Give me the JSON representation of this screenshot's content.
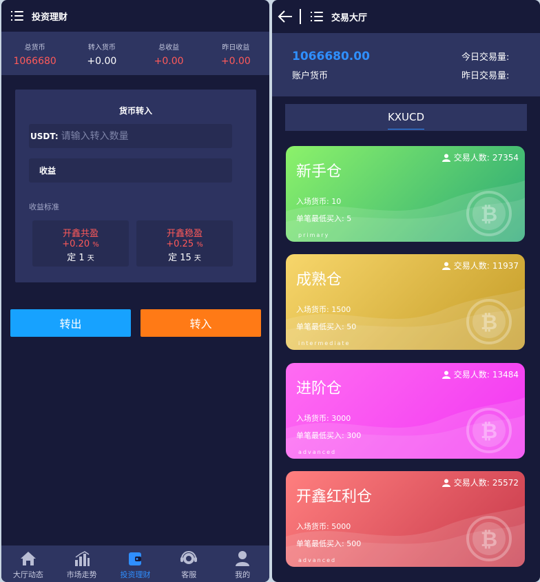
{
  "left": {
    "header_title": "投资理财",
    "stats": [
      {
        "label": "总货币",
        "value": "1066680",
        "color": "red"
      },
      {
        "label": "转入货币",
        "value": "+0.00",
        "color": "white"
      },
      {
        "label": "总收益",
        "value": "+0.00",
        "color": "red"
      },
      {
        "label": "昨日收益",
        "value": "+0.00",
        "color": "red"
      }
    ],
    "transfer": {
      "title": "货币转入",
      "usdt_label": "USDT:",
      "usdt_placeholder": "请输入转入数量",
      "usdt_value": "",
      "income_label": "收益",
      "standard_label": "收益标准",
      "plans": [
        {
          "name": "开鑫共盈",
          "rate": "+0.20",
          "rate_unit": "%",
          "term_prefix": "定",
          "term_value": "1",
          "term_unit": "天"
        },
        {
          "name": "开鑫稳盈",
          "rate": "+0.25",
          "rate_unit": "%",
          "term_prefix": "定",
          "term_value": "15",
          "term_unit": "天"
        }
      ]
    },
    "buttons": {
      "out_label": "转出",
      "in_label": "转入",
      "out_color": "#17a2ff",
      "in_color": "#ff7a16"
    },
    "tabs": [
      {
        "label": "大厅动态",
        "icon": "home-icon",
        "active": false
      },
      {
        "label": "市场走势",
        "icon": "chart-icon",
        "active": false
      },
      {
        "label": "投资理财",
        "icon": "wallet-icon",
        "active": true
      },
      {
        "label": "客服",
        "icon": "headset-icon",
        "active": false
      },
      {
        "label": "我的",
        "icon": "user-icon",
        "active": false
      }
    ]
  },
  "right": {
    "header_title": "交易大厅",
    "account_amount": "1066680.00",
    "account_label": "账户货币",
    "today_label": "今日交易量:",
    "yesterday_label": "昨日交易量:",
    "market_tab": "KXUCD",
    "rooms": [
      {
        "name": "新手仓",
        "count_label": "交易人数:",
        "count": "27354",
        "entry": "入场货币: 10",
        "min_buy": "单笔最低买入: 5",
        "tag": "primary",
        "c1": "#8cf26a",
        "c2": "#2aa876"
      },
      {
        "name": "成熟仓",
        "count_label": "交易人数:",
        "count": "11937",
        "entry": "入场货币: 1500",
        "min_buy": "单笔最低买入: 50",
        "tag": "intermediate",
        "c1": "#f7d66b",
        "c2": "#c49b26"
      },
      {
        "name": "进阶仓",
        "count_label": "交易人数:",
        "count": "13484",
        "entry": "入场货币: 3000",
        "min_buy": "单笔最低买入: 300",
        "tag": "advanced",
        "c1": "#ff6cf2",
        "c2": "#f236f2"
      },
      {
        "name": "开鑫红利仓",
        "count_label": "交易人数:",
        "count": "25572",
        "entry": "入场货币: 5000",
        "min_buy": "单笔最低买入: 500",
        "tag": "advanced",
        "c1": "#ff7f7f",
        "c2": "#c7384a"
      }
    ]
  }
}
